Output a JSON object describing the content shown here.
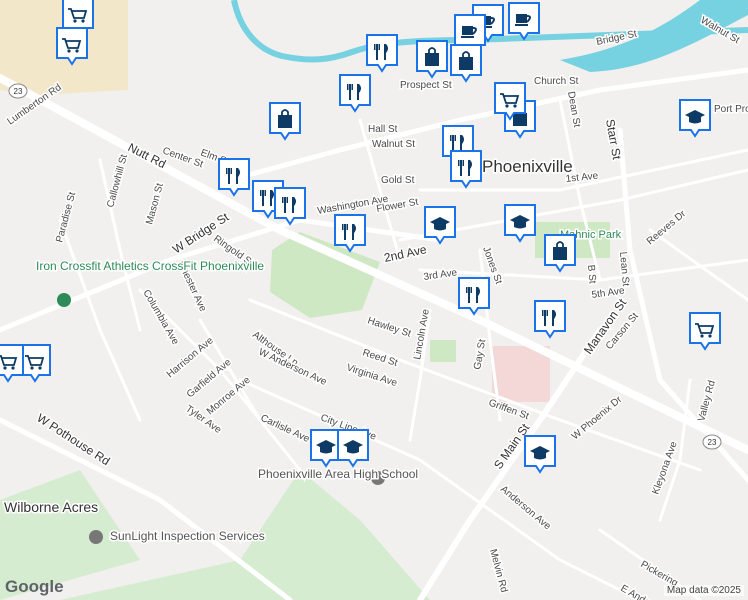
{
  "labels": {
    "streets": [
      "Bridge St",
      "Church St",
      "Prospect St",
      "Hall St",
      "Walnut St",
      "Gold St",
      "Washington Ave",
      "Flower St",
      "2nd Ave",
      "3rd Ave",
      "Jones St",
      "Lean St",
      "B St",
      "5th Ave",
      "Starr St",
      "Dean St",
      "1st Ave",
      "Nutt Rd",
      "Center St",
      "Elm St",
      "Lumberton Rd",
      "Callowhill St",
      "Mason St",
      "Paradise St",
      "W Bridge St",
      "Ringold St",
      "Chester Ave",
      "Columbia Ave",
      "Harrison Ave",
      "Garfield Ave",
      "Monroe Ave",
      "Tyler Ave",
      "Althouse Ln",
      "W Anderson Ave",
      "Hawley St",
      "Reed St",
      "Virginia Ave",
      "Lincoln Ave",
      "Gay St",
      "Griffen St",
      "City Line Ave",
      "Carlisle Ave",
      "W Pothouse Rd",
      "S Main St",
      "Anderson Ave",
      "Melvin Rd",
      "W Phoenix Dr",
      "Manavon St",
      "Carson St",
      "Reeves Dr",
      "Kleyona Ave",
      "Valley Rd",
      "Pickering",
      "E Anderson",
      "Walnut St",
      "Port Providence Rd"
    ],
    "places": [
      "Phoenixville",
      "Wilborne Acres",
      "Mahnic Park"
    ],
    "pois": [
      "Iron Crossfit Athletics CrossFit Phoenixville",
      "Phoenixville Area High School",
      "SunLight Inspection Services"
    ],
    "route_number": "23",
    "logo": "Google",
    "attribution": "Map data ©2025"
  },
  "colors": {
    "pin": "#1a73e8",
    "pin_icon": "#0d3b66",
    "park": "#cfe8c4",
    "river": "#76d1e0",
    "sand": "#f2e7c9",
    "road": "#ffffff"
  },
  "markers": [
    {
      "type": "shopping-cart-icon"
    },
    {
      "type": "shopping-cart-icon"
    },
    {
      "type": "coffee-cup-icon"
    },
    {
      "type": "coffee-cup-icon"
    },
    {
      "type": "coffee-cup-icon"
    },
    {
      "type": "shopping-bag-icon"
    },
    {
      "type": "shopping-bag-icon"
    },
    {
      "type": "shopping-bag-icon"
    },
    {
      "type": "shopping-bag-icon"
    },
    {
      "type": "shopping-bag-icon"
    },
    {
      "type": "restaurant-icon"
    },
    {
      "type": "restaurant-icon"
    },
    {
      "type": "restaurant-icon"
    },
    {
      "type": "restaurant-icon"
    },
    {
      "type": "restaurant-icon"
    },
    {
      "type": "restaurant-icon"
    },
    {
      "type": "restaurant-icon"
    },
    {
      "type": "restaurant-icon"
    },
    {
      "type": "restaurant-icon"
    },
    {
      "type": "restaurant-icon"
    },
    {
      "type": "school-icon"
    },
    {
      "type": "school-icon"
    },
    {
      "type": "school-icon"
    },
    {
      "type": "school-icon"
    },
    {
      "type": "school-icon"
    },
    {
      "type": "school-icon"
    },
    {
      "type": "shopping-cart-icon"
    },
    {
      "type": "shopping-cart-icon"
    },
    {
      "type": "shopping-cart-icon"
    },
    {
      "type": "shopping-cart-icon"
    }
  ]
}
